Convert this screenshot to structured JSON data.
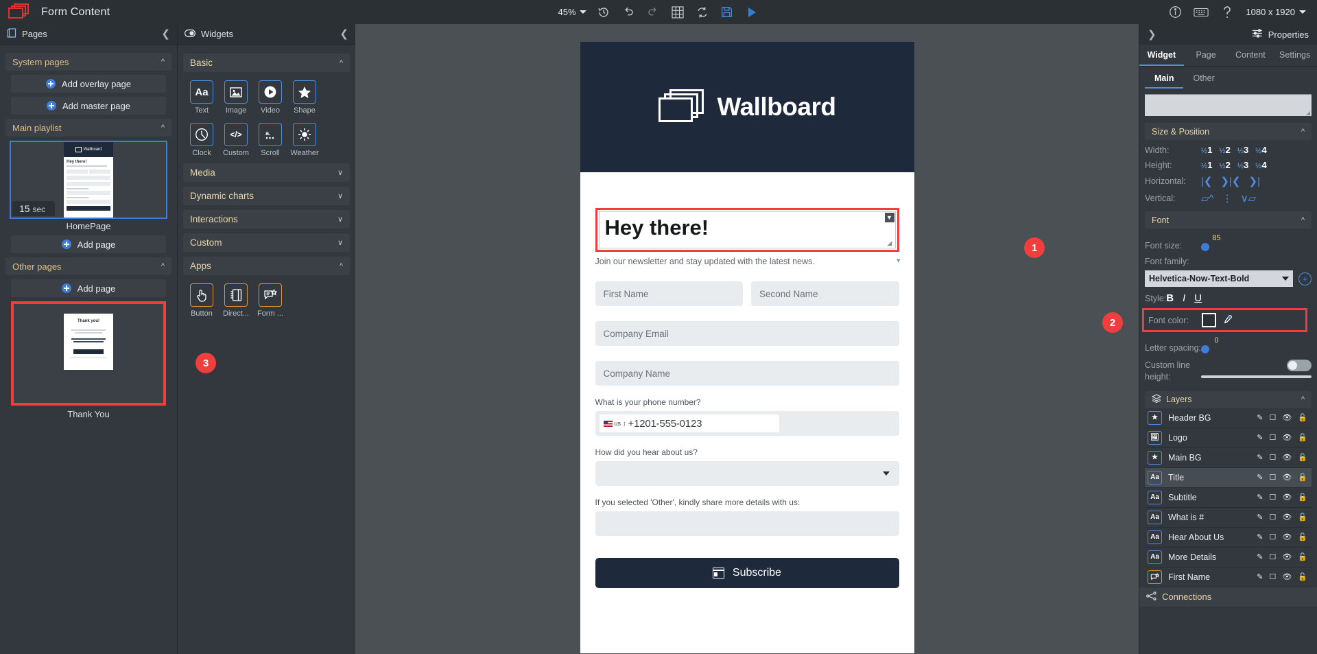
{
  "topbar": {
    "app_title": "Form Content",
    "logo_icon": "wallboard-logo-icon",
    "zoom": "45%",
    "icons": [
      "history-icon",
      "undo-icon",
      "redo-icon",
      "grid-icon",
      "refresh-icon",
      "save-icon",
      "play-icon"
    ],
    "info_icon": "info-icon",
    "keyboard_icon": "keyboard-icon",
    "help_icon": "help-icon",
    "resolution": "1080 x 1920"
  },
  "pages_panel": {
    "title": "Pages",
    "collapse_icon": "chevron-left-icon",
    "sections": [
      {
        "label": "System pages",
        "expanded": true
      },
      {
        "label": "Main playlist",
        "expanded": true
      },
      {
        "label": "Other pages",
        "expanded": true
      }
    ],
    "add_overlay_page": "Add overlay page",
    "add_master_page": "Add master page",
    "add_page": "Add page",
    "add_page_other": "Add page",
    "pages": [
      {
        "name": "HomePage",
        "duration": "15",
        "duration_unit": "sec",
        "selected": true
      },
      {
        "name": "Thank You",
        "highlighted": true
      }
    ],
    "mini_home": {
      "logo_text": "Wallboard",
      "heading": "Hey there!"
    },
    "mini_thanks": {
      "heading": "Thank you!"
    }
  },
  "widgets_panel": {
    "title": "Widgets",
    "collapse_icon": "chevron-left-icon",
    "groups": [
      {
        "label": "Basic",
        "expanded": true
      },
      {
        "label": "Media",
        "expanded": false
      },
      {
        "label": "Dynamic charts",
        "expanded": false
      },
      {
        "label": "Interactions",
        "expanded": false
      },
      {
        "label": "Custom",
        "expanded": false
      },
      {
        "label": "Apps",
        "expanded": true
      }
    ],
    "basic_items": [
      {
        "label": "Text",
        "icon": "text-aa-icon"
      },
      {
        "label": "Image",
        "icon": "image-icon"
      },
      {
        "label": "Video",
        "icon": "video-play-icon"
      },
      {
        "label": "Shape",
        "icon": "star-shape-icon"
      },
      {
        "label": "Clock",
        "icon": "clock-icon"
      },
      {
        "label": "Custom",
        "icon": "code-icon"
      },
      {
        "label": "Scroll",
        "icon": "scroll-text-icon"
      },
      {
        "label": "Weather",
        "icon": "weather-sun-icon"
      }
    ],
    "apps_items": [
      {
        "label": "Button",
        "icon": "touch-button-icon"
      },
      {
        "label": "Direct...",
        "icon": "directory-icon"
      },
      {
        "label": "Form ...",
        "icon": "form-icon"
      }
    ]
  },
  "canvas": {
    "header_logo_text": "Wallboard",
    "title": "Hey there!",
    "subtitle": "Join our newsletter and stay updated with the latest news.",
    "first_name_placeholder": "First Name",
    "second_name_placeholder": "Second Name",
    "company_email_placeholder": "Company Email",
    "company_name_placeholder": "Company Name",
    "phone_label": "What is your phone number?",
    "phone_country": "us",
    "phone_value": "+1201-555-0123",
    "hear_label": "How did you hear about us?",
    "hear_value": "",
    "details_label": "If you selected 'Other', kindly share more details with us:",
    "details_value": "",
    "subscribe_label": "Subscribe",
    "subscribe_icon": "form-subscribe-icon"
  },
  "annotations": [
    {
      "number": "1"
    },
    {
      "number": "2"
    },
    {
      "number": "3"
    }
  ],
  "properties": {
    "title": "Properties",
    "expand_icon": "chevron-right-icon",
    "settings_icon": "sliders-icon",
    "tabs": [
      {
        "label": "Widget",
        "active": true
      },
      {
        "label": "Page",
        "active": false
      },
      {
        "label": "Content",
        "active": false
      },
      {
        "label": "Settings",
        "active": false
      }
    ],
    "subtabs": [
      {
        "label": "Main",
        "active": true
      },
      {
        "label": "Other",
        "active": false
      }
    ],
    "size_position": {
      "section_label": "Size & Position",
      "width_label": "Width:",
      "height_label": "Height:",
      "horizontal_label": "Horizontal:",
      "vertical_label": "Vertical:",
      "fractions": [
        "1",
        "2",
        "3",
        "4"
      ]
    },
    "font": {
      "section_label": "Font",
      "font_size_label": "Font size:",
      "font_size_value": "85",
      "font_family_label": "Font family:",
      "font_family_value": "Helvetica-Now-Text-Bold",
      "style_label": "Style:",
      "style_bold": "B",
      "style_italic": "I",
      "style_underline": "U",
      "font_color_label": "Font color:",
      "font_color_value": "#2b3035",
      "eyedropper_icon": "eyedropper-icon",
      "letter_spacing_label": "Letter spacing:",
      "letter_spacing_value": "0",
      "custom_line_height_label": "Custom line height:",
      "custom_line_height_on": false
    },
    "layers": {
      "section_label": "Layers",
      "items": [
        {
          "name": "Header BG",
          "icon": "star-shape-icon",
          "type": "blue",
          "active": false
        },
        {
          "name": "Logo",
          "icon": "image-icon",
          "type": "blue",
          "active": false
        },
        {
          "name": "Main BG",
          "icon": "star-shape-icon",
          "type": "blue",
          "active": false
        },
        {
          "name": "Title",
          "icon": "text-aa-icon",
          "type": "blue",
          "active": true
        },
        {
          "name": "Subtitle",
          "icon": "text-aa-icon",
          "type": "blue",
          "active": false
        },
        {
          "name": "What is #",
          "icon": "text-aa-icon",
          "type": "blue",
          "active": false
        },
        {
          "name": "Hear About Us",
          "icon": "text-aa-icon",
          "type": "blue",
          "active": false
        },
        {
          "name": "More Details",
          "icon": "text-aa-icon",
          "type": "blue",
          "active": false
        },
        {
          "name": "First Name",
          "icon": "form-icon",
          "type": "orange",
          "active": false
        }
      ],
      "row_actions": [
        "edit-pencil-icon",
        "select-box-icon",
        "eye-visibility-icon",
        "lock-open-icon"
      ]
    },
    "connections_label": "Connections",
    "connections_icon": "connections-icon"
  }
}
